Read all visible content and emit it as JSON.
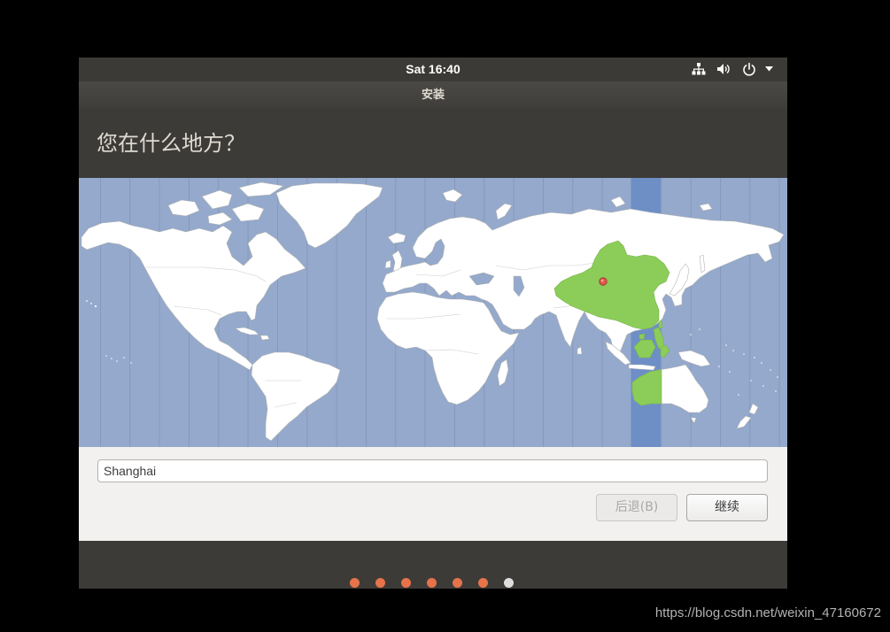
{
  "top_panel": {
    "clock": "Sat 16:40",
    "indicators": {
      "network": "network-icon",
      "volume": "volume-icon",
      "power": "power-icon",
      "menu": "menu-arrow-icon"
    }
  },
  "installer": {
    "title": "安装",
    "heading": "您在什么地方？",
    "map_colors": {
      "ocean": "#94a9cb",
      "land": "#ffffff",
      "selected_zone": "#6d8fc6",
      "selected_region": "#8bcd58",
      "pin": "#e2574c"
    },
    "location_field": {
      "value": "Shanghai"
    },
    "buttons": {
      "back": "后退(B)",
      "continue": "继续"
    }
  },
  "progress": {
    "total_steps": 7,
    "current_step": 7,
    "completed_color": "#e6734a",
    "current_color": "#dedede"
  },
  "watermark": "https://blog.csdn.net/weixin_47160672"
}
